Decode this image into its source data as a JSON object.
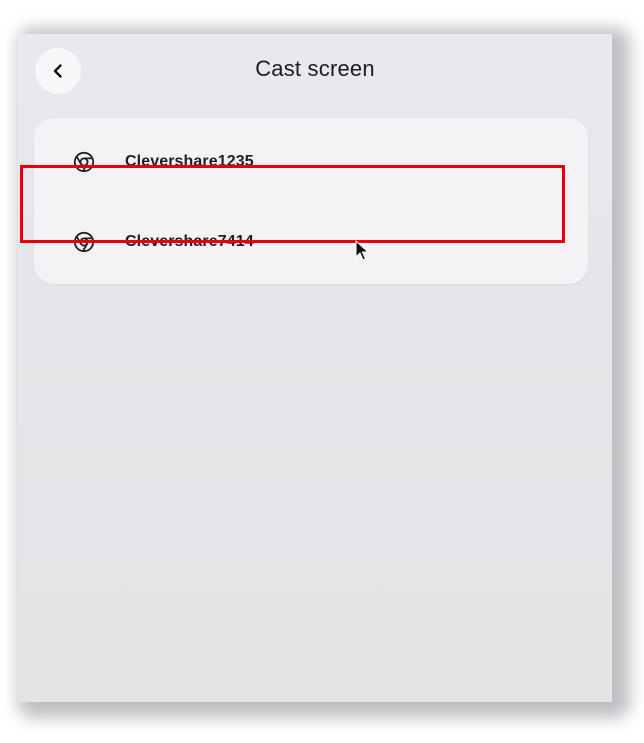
{
  "header": {
    "title": "Cast screen",
    "back_icon": "chevron-left-icon"
  },
  "devices": [
    {
      "label": "Clevershare1235",
      "icon": "chrome-cast-icon"
    },
    {
      "label": "Clevershare7414",
      "icon": "chrome-cast-icon"
    }
  ],
  "colors": {
    "highlight": "#e8000c",
    "panel_bg": "#e6e6ea",
    "list_bg": "#f3f3f6",
    "text": "#1f1f22"
  }
}
